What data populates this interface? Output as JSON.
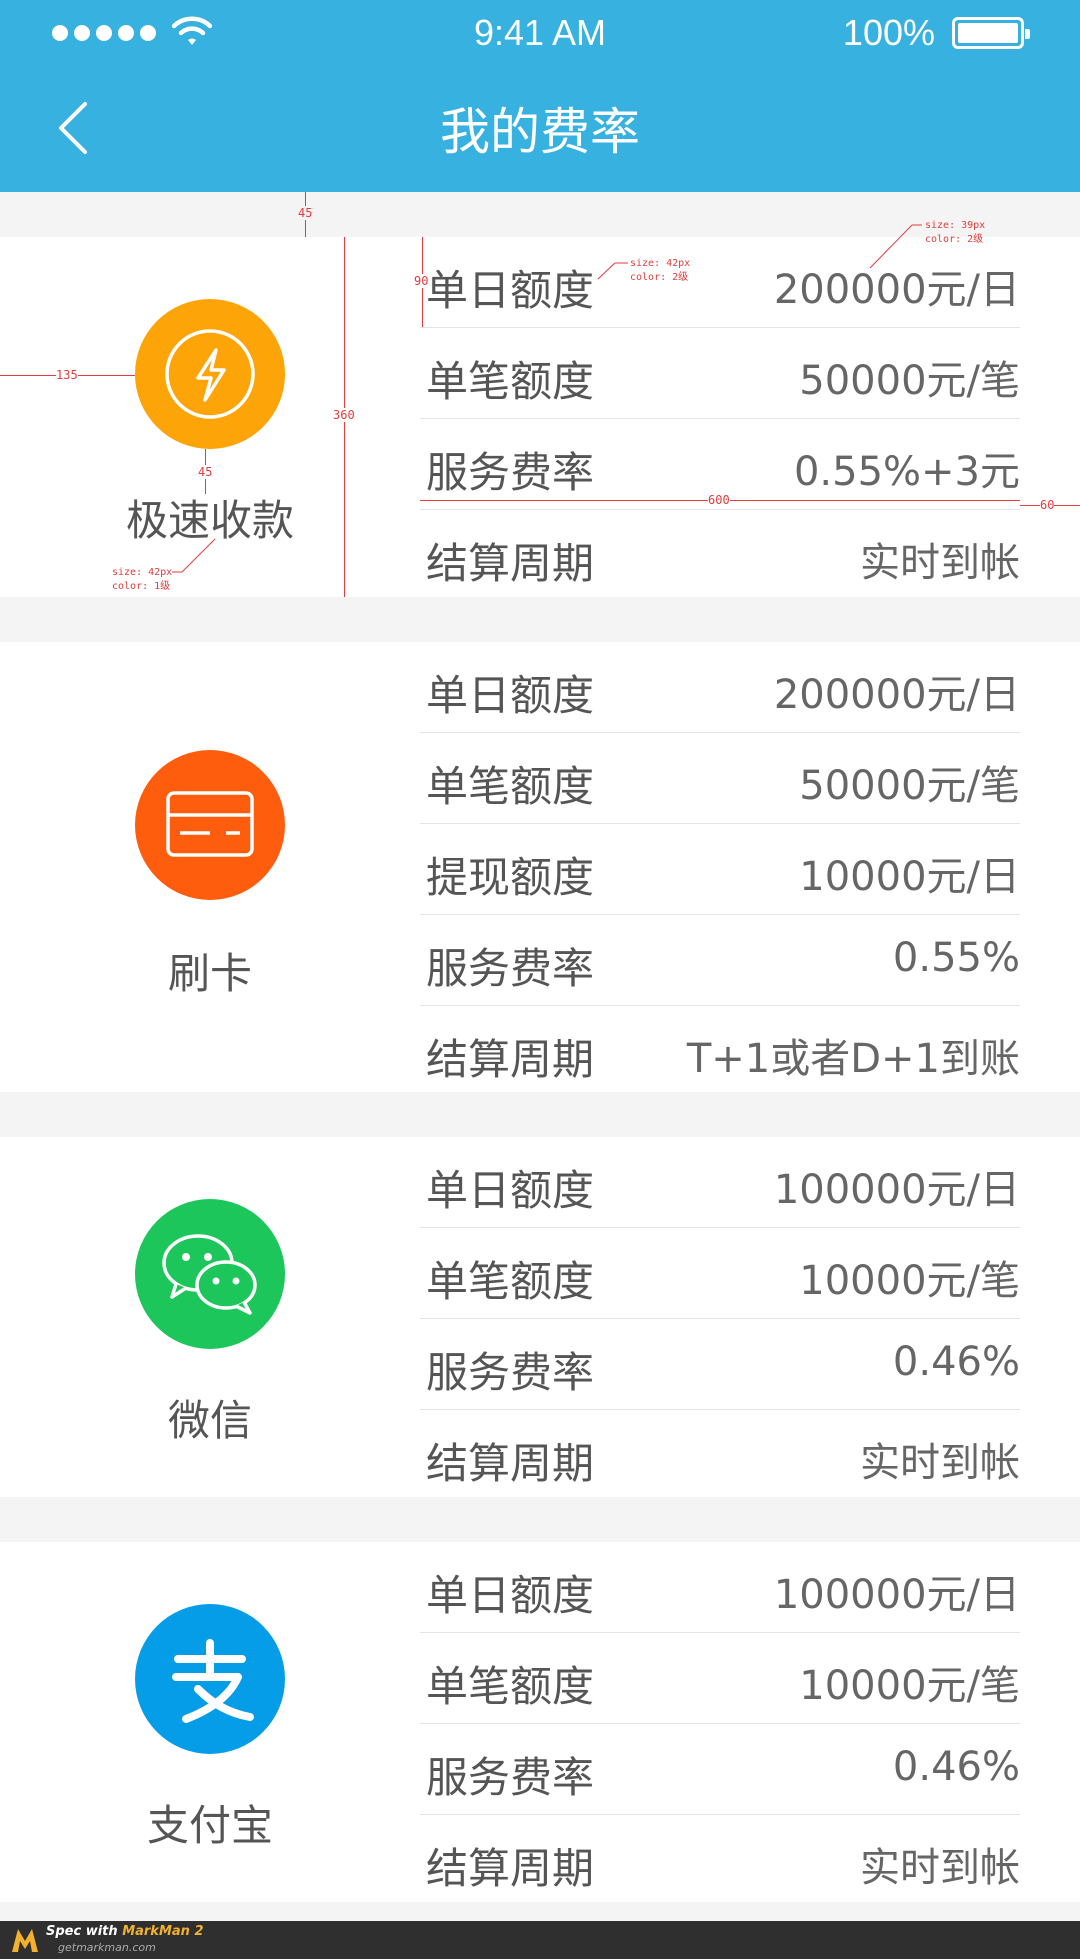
{
  "status_bar": {
    "time": "9:41 AM",
    "battery": "100%"
  },
  "header": {
    "title": "我的费率"
  },
  "cards": [
    {
      "name": "极速收款",
      "icon": "lightning-icon",
      "color": "#fca408",
      "rows": [
        {
          "label": "单日额度",
          "value": "200000元/日"
        },
        {
          "label": "单笔额度",
          "value": "50000元/笔"
        },
        {
          "label": "服务费率",
          "value": "0.55%+3元"
        },
        {
          "label": "结算周期",
          "value": "实时到帐"
        }
      ]
    },
    {
      "name": "刷卡",
      "icon": "card-icon",
      "color": "#fd5d0c",
      "rows": [
        {
          "label": "单日额度",
          "value": "200000元/日"
        },
        {
          "label": "单笔额度",
          "value": "50000元/笔"
        },
        {
          "label": "提现额度",
          "value": "10000元/日"
        },
        {
          "label": "服务费率",
          "value": "0.55%"
        },
        {
          "label": "结算周期",
          "value": "T+1或者D+1到账"
        }
      ]
    },
    {
      "name": "微信",
      "icon": "wechat-icon",
      "color": "#1cc65a",
      "rows": [
        {
          "label": "单日额度",
          "value": "100000元/日"
        },
        {
          "label": "单笔额度",
          "value": "10000元/笔"
        },
        {
          "label": "服务费率",
          "value": "0.46%"
        },
        {
          "label": "结算周期",
          "value": "实时到帐"
        }
      ]
    },
    {
      "name": "支付宝",
      "icon": "alipay-icon",
      "color": "#059de7",
      "rows": [
        {
          "label": "单日额度",
          "value": "100000元/日"
        },
        {
          "label": "单笔额度",
          "value": "10000元/笔"
        },
        {
          "label": "服务费率",
          "value": "0.46%"
        },
        {
          "label": "结算周期",
          "value": "实时到帐"
        }
      ]
    }
  ],
  "annotations": {
    "gap_top": "45",
    "row_height": "90",
    "card_height": "360",
    "left_margin": "135",
    "icon_gap": "45",
    "rows_width": "600",
    "right_margin": "60",
    "label_font_line1": "size: 42px",
    "label_font_line2": "color: 2级",
    "value_font_line1": "size: 39px",
    "value_font_line2": "color: 2级",
    "name_font_line1": "size: 42px",
    "name_font_line2": "color: 1级"
  },
  "footer": {
    "brand_prefix": "Spec with",
    "brand_name": "MarkMan 2",
    "url": "getmarkman.com"
  }
}
